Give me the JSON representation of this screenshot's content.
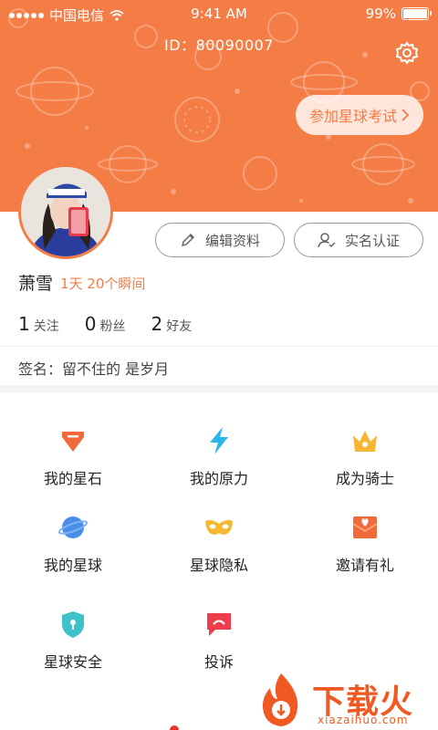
{
  "status": {
    "carrier": "中国电信",
    "time": "9:41 AM",
    "battery": "99%",
    "battery_level": 0.99
  },
  "profile": {
    "id_text": "ID：80090007",
    "exam_button": "参加星球考试",
    "name": "萧雪",
    "duration": "1天 20个瞬间",
    "edit_button": "编辑资料",
    "verify_button": "实名认证",
    "signature": "签名：留不住的 是岁月"
  },
  "stats": [
    {
      "count": "1",
      "label": "关注"
    },
    {
      "count": "0",
      "label": "粉丝"
    },
    {
      "count": "2",
      "label": "好友"
    }
  ],
  "menu": [
    {
      "label": "我的星石",
      "icon": "gem-icon",
      "color": "#f26a3c"
    },
    {
      "label": "我的原力",
      "icon": "lightning-icon",
      "color": "#29b6e8"
    },
    {
      "label": "成为骑士",
      "icon": "crown-icon",
      "color": "#f7b733"
    },
    {
      "label": "我的星球",
      "icon": "planet-icon",
      "color": "#4a8ee8"
    },
    {
      "label": "星球隐私",
      "icon": "mask-icon",
      "color": "#f5b82e"
    },
    {
      "label": "邀请有礼",
      "icon": "invite-envelope-icon",
      "color": "#f06a3a"
    },
    {
      "label": "星球安全",
      "icon": "shield-lock-icon",
      "color": "#3cc2c8"
    },
    {
      "label": "投诉",
      "icon": "complaint-bubble-icon",
      "color": "#ef3c4a"
    }
  ],
  "watermark": {
    "title": "下载火",
    "subtitle": "xiazaihuo.com"
  },
  "colors": {
    "accent": "#f47c45",
    "watermark": "#f05a22"
  }
}
